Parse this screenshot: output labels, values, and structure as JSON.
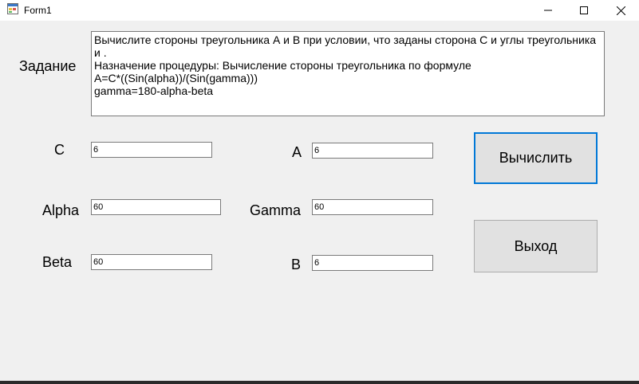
{
  "window": {
    "title": "Form1",
    "minimize_icon": "minimize-icon",
    "maximize_icon": "maximize-icon",
    "close_icon": "close-icon"
  },
  "task": {
    "label": "Задание",
    "text": "Вычислите стороны треугольника А и В при условии, что заданы сторона С и углы треугольника и .\nНазначение процедуры: Вычисление стороны треугольника по формуле\nA=C*((Sin(alpha))/(Sin(gamma)))\ngamma=180-alpha-beta"
  },
  "inputs": {
    "c": {
      "label": "C",
      "value": "6"
    },
    "alpha": {
      "label": "Alpha",
      "value": "60"
    },
    "beta": {
      "label": "Beta",
      "value": "60"
    },
    "a": {
      "label": "A",
      "value": "6"
    },
    "gamma": {
      "label": "Gamma",
      "value": "60"
    },
    "b": {
      "label": "B",
      "value": "6"
    }
  },
  "buttons": {
    "calculate": "Вычислить",
    "exit": "Выход"
  },
  "colors": {
    "background": "#f0f0f0",
    "accent_border": "#0078d7",
    "button_face": "#e1e1e1"
  }
}
